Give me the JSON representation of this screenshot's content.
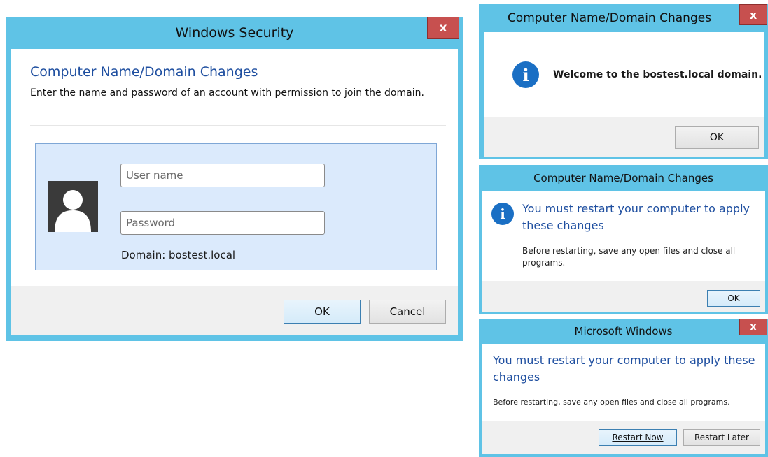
{
  "security_dialog": {
    "title": "Windows Security",
    "close_glyph": "x",
    "heading": "Computer Name/Domain Changes",
    "description": "Enter the name and password of an account with permission to join the domain.",
    "username_placeholder": "User name",
    "password_placeholder": "Password",
    "domain_text": "Domain: bostest.local",
    "ok_label": "OK",
    "cancel_label": "Cancel",
    "icon": "user-avatar-icon"
  },
  "welcome_dialog": {
    "title": "Computer Name/Domain Changes",
    "close_glyph": "x",
    "message": "Welcome to the bostest.local domain.",
    "ok_label": "OK",
    "icon": "info-icon"
  },
  "restart_info_dialog": {
    "title": "Computer Name/Domain Changes",
    "heading": "You must restart your computer to apply these changes",
    "body": "Before restarting, save any open files and close all programs.",
    "ok_label": "OK",
    "icon": "info-icon"
  },
  "restart_prompt_dialog": {
    "title": "Microsoft Windows",
    "close_glyph": "x",
    "heading": "You must restart your computer to apply these changes",
    "body": "Before restarting, save any open files and close all programs.",
    "restart_now_label": "Restart Now",
    "restart_later_label": "Restart Later"
  },
  "colors": {
    "frame": "#5fc3e6",
    "close_button": "#c7504f",
    "heading_blue": "#1f4fa0",
    "info_icon": "#1a6fc4",
    "credential_panel": "#dbeafc"
  }
}
